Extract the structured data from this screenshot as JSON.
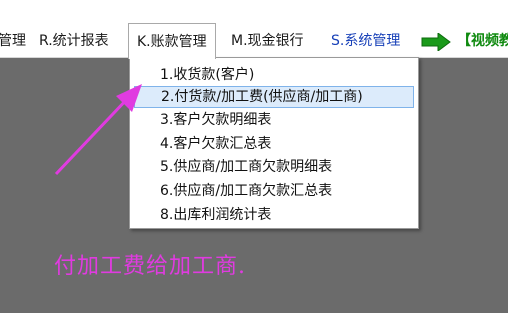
{
  "menubar": {
    "items": [
      {
        "label": "管理"
      },
      {
        "label": "R.统计报表"
      },
      {
        "label": "K.账款管理"
      },
      {
        "label": "M.现金银行"
      },
      {
        "label": "S.系统管理"
      },
      {
        "label": "【视频教"
      }
    ]
  },
  "dropdown": {
    "items": [
      {
        "label": "1.收货款(客户)"
      },
      {
        "label": "2.付货款/加工费(供应商/加工商)"
      },
      {
        "label": "3.客户欠款明细表"
      },
      {
        "label": "4.客户欠款汇总表"
      },
      {
        "label": "5.供应商/加工商欠款明细表"
      },
      {
        "label": "6.供应商/加工商欠款汇总表"
      },
      {
        "label": "8.出库利润统计表"
      }
    ]
  },
  "annotation": {
    "caption": "付加工费给加工商."
  },
  "colors": {
    "menu_blue": "#1740b8",
    "menu_green": "#0f8a0f",
    "arrow_green": "#1a9a1a",
    "highlight_bg": "#dcebfb",
    "highlight_border": "#7fb3ea",
    "annotation_magenta": "#e03be0"
  }
}
